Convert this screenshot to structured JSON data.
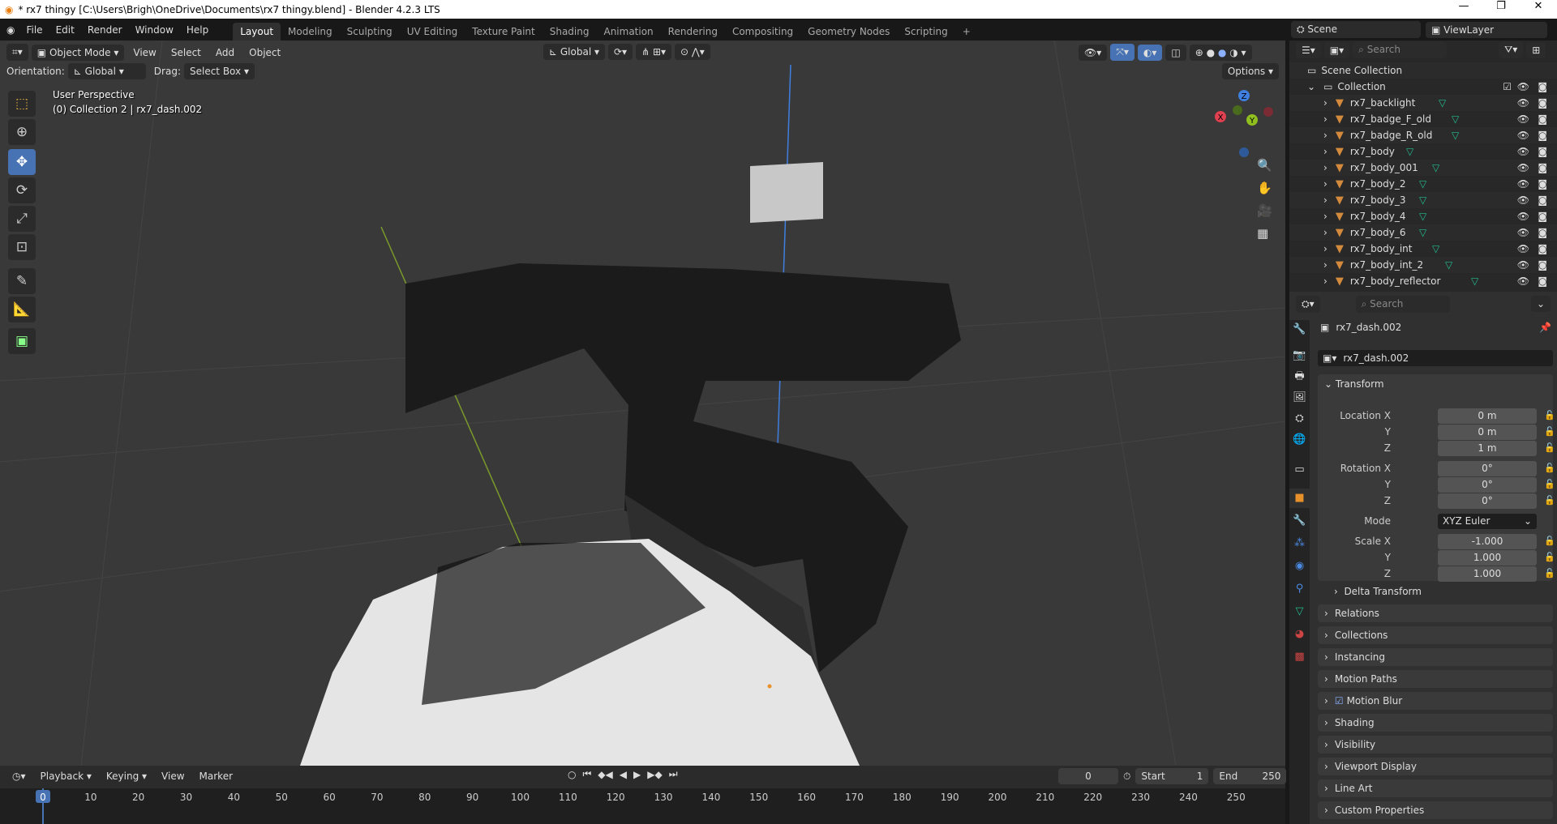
{
  "window": {
    "title": "* rx7 thingy [C:\\Users\\Brigh\\OneDrive\\Documents\\rx7 thingy.blend] - Blender 4.2.3 LTS",
    "minimize": "—",
    "maximize": "❐",
    "close": "✕"
  },
  "menu": [
    "File",
    "Edit",
    "Render",
    "Window",
    "Help"
  ],
  "workspaces": [
    "Layout",
    "Modeling",
    "Sculpting",
    "UV Editing",
    "Texture Paint",
    "Shading",
    "Animation",
    "Rendering",
    "Compositing",
    "Geometry Nodes",
    "Scripting",
    "+"
  ],
  "viewport": {
    "mode": "Object Mode",
    "menus": [
      "View",
      "Select",
      "Add",
      "Object"
    ],
    "transform_orientation": "Global",
    "orientation_label": "Orientation:",
    "orientation_value": "Global",
    "drag_label": "Drag:",
    "drag_value": "Select Box",
    "options": "Options",
    "overlay_line1": "User Perspective",
    "overlay_line2": "(0) Collection 2 | rx7_dash.002",
    "gizmo": {
      "x": "X",
      "y": "Y",
      "z": "Z"
    }
  },
  "scene": {
    "scene_name": "Scene",
    "view_layer": "ViewLayer"
  },
  "outliner": {
    "search_placeholder": "Search",
    "scene_collection": "Scene Collection",
    "collection": "Collection",
    "items": [
      "rx7_backlight",
      "rx7_badge_F_old",
      "rx7_badge_R_old",
      "rx7_body",
      "rx7_body_001",
      "rx7_body_2",
      "rx7_body_3",
      "rx7_body_4",
      "rx7_body_6",
      "rx7_body_int",
      "rx7_body_int_2",
      "rx7_body_reflector"
    ]
  },
  "properties": {
    "search_placeholder": "Search",
    "object_name": "rx7_dash.002",
    "datablock_name": "rx7_dash.002",
    "transform_title": "Transform",
    "location": {
      "label": "Location X",
      "x": "0 m",
      "y": "0 m",
      "z": "1 m"
    },
    "rotation": {
      "label": "Rotation X",
      "x": "0°",
      "y": "0°",
      "z": "0°"
    },
    "mode_label": "Mode",
    "mode_value": "XYZ Euler",
    "scale": {
      "label": "Scale X",
      "x": "-1.000",
      "y": "1.000",
      "z": "1.000"
    },
    "axis": {
      "y": "Y",
      "z": "Z"
    },
    "delta": "Delta Transform",
    "panels": [
      "Relations",
      "Collections",
      "Instancing",
      "Motion Paths",
      "Motion Blur",
      "Shading",
      "Visibility",
      "Viewport Display",
      "Line Art",
      "Custom Properties"
    ]
  },
  "timeline": {
    "menus": [
      "Playback",
      "Keying",
      "View",
      "Marker"
    ],
    "current_frame": "0",
    "start_label": "Start",
    "start": "1",
    "end_label": "End",
    "end": "250",
    "ticks": [
      "0",
      "10",
      "20",
      "30",
      "40",
      "50",
      "60",
      "70",
      "80",
      "90",
      "100",
      "110",
      "120",
      "130",
      "140",
      "150",
      "160",
      "170",
      "180",
      "190",
      "200",
      "210",
      "220",
      "230",
      "240",
      "250"
    ]
  }
}
